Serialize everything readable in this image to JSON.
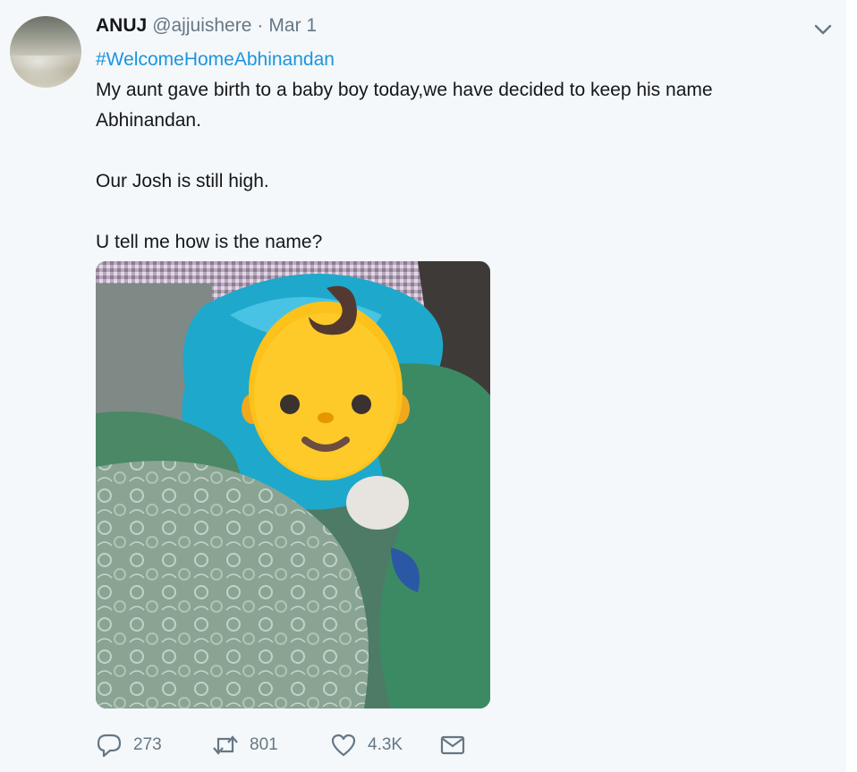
{
  "tweet": {
    "author_name": "ANUJ",
    "handle": "@ajjuishere",
    "separator": "·",
    "date": "Mar 1",
    "hashtag": "#WelcomeHomeAbhinandan",
    "lines": [
      "My aunt gave birth to a baby boy today,we have decided to keep his name",
      "Abhinandan.",
      "",
      "Our Josh is still high.",
      "",
      "U tell me how is the name?"
    ],
    "media_icon": "baby-face-emoji",
    "menu_icon": "chevron-down-icon"
  },
  "actions": {
    "reply_icon": "reply-icon",
    "reply_count": "273",
    "retweet_icon": "retweet-icon",
    "retweet_count": "801",
    "like_icon": "heart-icon",
    "like_count": "4.3K",
    "dm_icon": "envelope-icon"
  },
  "colors": {
    "background": "#f5f8fa",
    "text": "#14171a",
    "secondary": "#657786",
    "link": "#1b95e0"
  }
}
